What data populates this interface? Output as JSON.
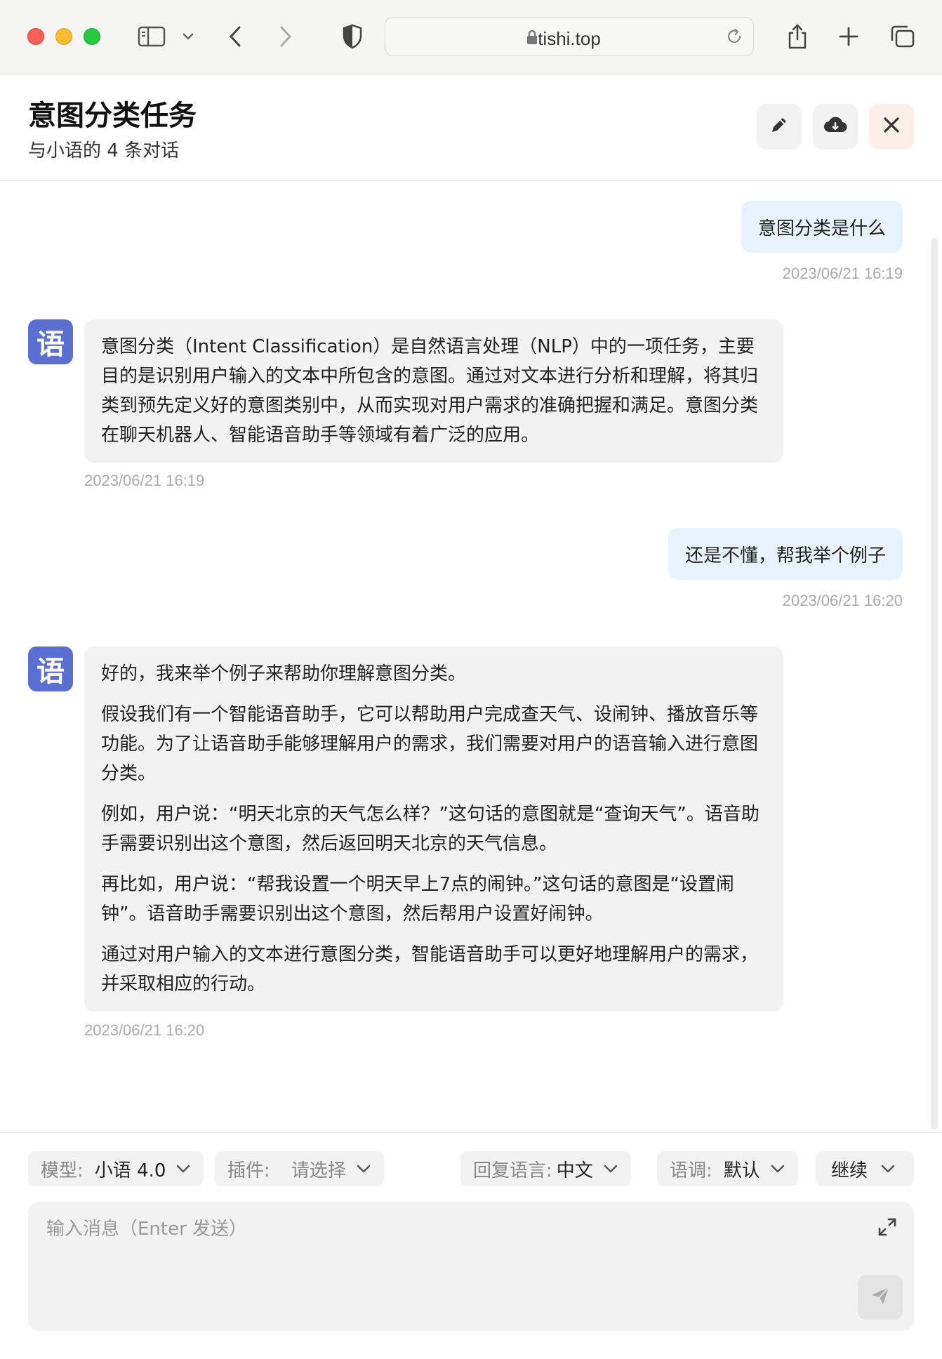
{
  "browser": {
    "url": "tishi.top",
    "icons": [
      "sidebar-icon",
      "chevron-down-icon",
      "back-icon",
      "forward-icon",
      "shield-icon",
      "lock-icon",
      "reload-icon",
      "share-icon",
      "plus-icon",
      "tabs-icon"
    ]
  },
  "header": {
    "title": "意图分类任务",
    "subtitle": "与小语的 4 条对话",
    "buttons": [
      "edit-icon",
      "cloud-download-icon",
      "close-icon"
    ]
  },
  "avatar_glyph": "语",
  "messages": [
    {
      "role": "user",
      "text": "意图分类是什么",
      "time": "2023/06/21 16:19"
    },
    {
      "role": "assistant",
      "paragraphs": [
        "意图分类（Intent Classification）是自然语言处理（NLP）中的一项任务，主要目的是识别用户输入的文本中所包含的意图。通过对文本进行分析和理解，将其归类到预先定义好的意图类别中，从而实现对用户需求的准确把握和满足。意图分类在聊天机器人、智能语音助手等领域有着广泛的应用。"
      ],
      "time": "2023/06/21 16:19"
    },
    {
      "role": "user",
      "text": "还是不懂，帮我举个例子",
      "time": "2023/06/21 16:20"
    },
    {
      "role": "assistant",
      "paragraphs": [
        "好的，我来举个例子来帮助你理解意图分类。",
        "假设我们有一个智能语音助手，它可以帮助用户完成查天气、设闹钟、播放音乐等功能。为了让语音助手能够理解用户的需求，我们需要对用户的语音输入进行意图分类。",
        "例如，用户说：“明天北京的天气怎么样？”这句话的意图就是“查询天气”。语音助手需要识别出这个意图，然后返回明天北京的天气信息。",
        "再比如，用户说：“帮我设置一个明天早上7点的闹钟。”这句话的意图是“设置闹钟”。语音助手需要识别出这个意图，然后帮用户设置好闹钟。",
        "通过对用户输入的文本进行意图分类，智能语音助手可以更好地理解用户的需求，并采取相应的行动。"
      ],
      "time": "2023/06/21 16:20"
    }
  ],
  "controls": {
    "model_label": "模型:",
    "model_value": "小语 4.0",
    "plugin_label": "插件:",
    "plugin_value": "请选择",
    "reply_lang_label": "回复语言:",
    "reply_lang_value": "中文",
    "tone_label": "语调:",
    "tone_value": "默认",
    "continue_label": "继续"
  },
  "input": {
    "placeholder": "输入消息（Enter 发送）",
    "value": ""
  },
  "colors": {
    "user_bubble": "#e8f2fc",
    "bot_bubble": "#f2f2f2",
    "avatar": "#5b6fd0",
    "close_button_bg": "#fcefe8"
  }
}
